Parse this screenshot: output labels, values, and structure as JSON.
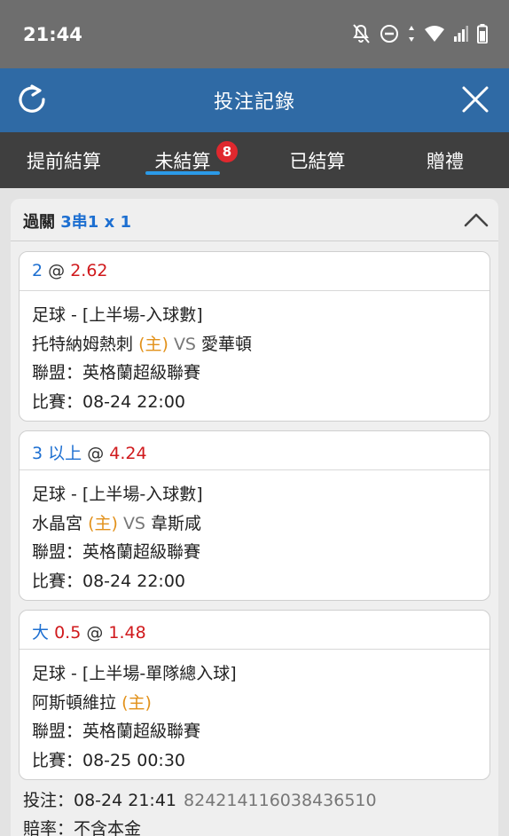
{
  "status": {
    "time": "21:44"
  },
  "header": {
    "title": "投注記錄"
  },
  "tabs": [
    {
      "label": "提前結算"
    },
    {
      "label": "未結算",
      "badge": "8"
    },
    {
      "label": "已結算"
    },
    {
      "label": "贈禮"
    }
  ],
  "parlay": {
    "label": "過關",
    "combo": "3串1 x 1"
  },
  "bets": [
    {
      "pick": "2",
      "at": "@",
      "odds": "2.62",
      "market": "足球 - [上半場-入球數]",
      "home": "托特納姆熱刺",
      "home_tag": "(主)",
      "vs": "VS",
      "away": "愛華頓",
      "league": "聯盟：英格蘭超級聯賽",
      "match": "比賽：08-24 22:00"
    },
    {
      "pick": "3 以上",
      "at": "@",
      "odds": "4.24",
      "market": "足球 - [上半場-入球數]",
      "home": "水晶宮",
      "home_tag": "(主)",
      "vs": "VS",
      "away": "韋斯咸",
      "league": "聯盟：英格蘭超級聯賽",
      "match": "比賽：08-24 22:00"
    },
    {
      "pick": "大",
      "line": "0.5",
      "at": "@",
      "odds": "1.48",
      "market": "足球 - [上半場-單隊總入球]",
      "home": "阿斯頓維拉",
      "home_tag": "(主)",
      "league": "聯盟：英格蘭超級聯賽",
      "match": "比賽：08-25 00:30"
    }
  ],
  "footer": {
    "bet_time": "投注：08-24 21:41",
    "bet_id": "824214116038436510",
    "odds_note": "賠率：不含本金"
  },
  "colors": {
    "header": "#2f6aa5",
    "tabs": "#3f3f3f",
    "accent": "#2b9ae8",
    "badge": "#e0282e",
    "home_tag": "#e2911a"
  }
}
